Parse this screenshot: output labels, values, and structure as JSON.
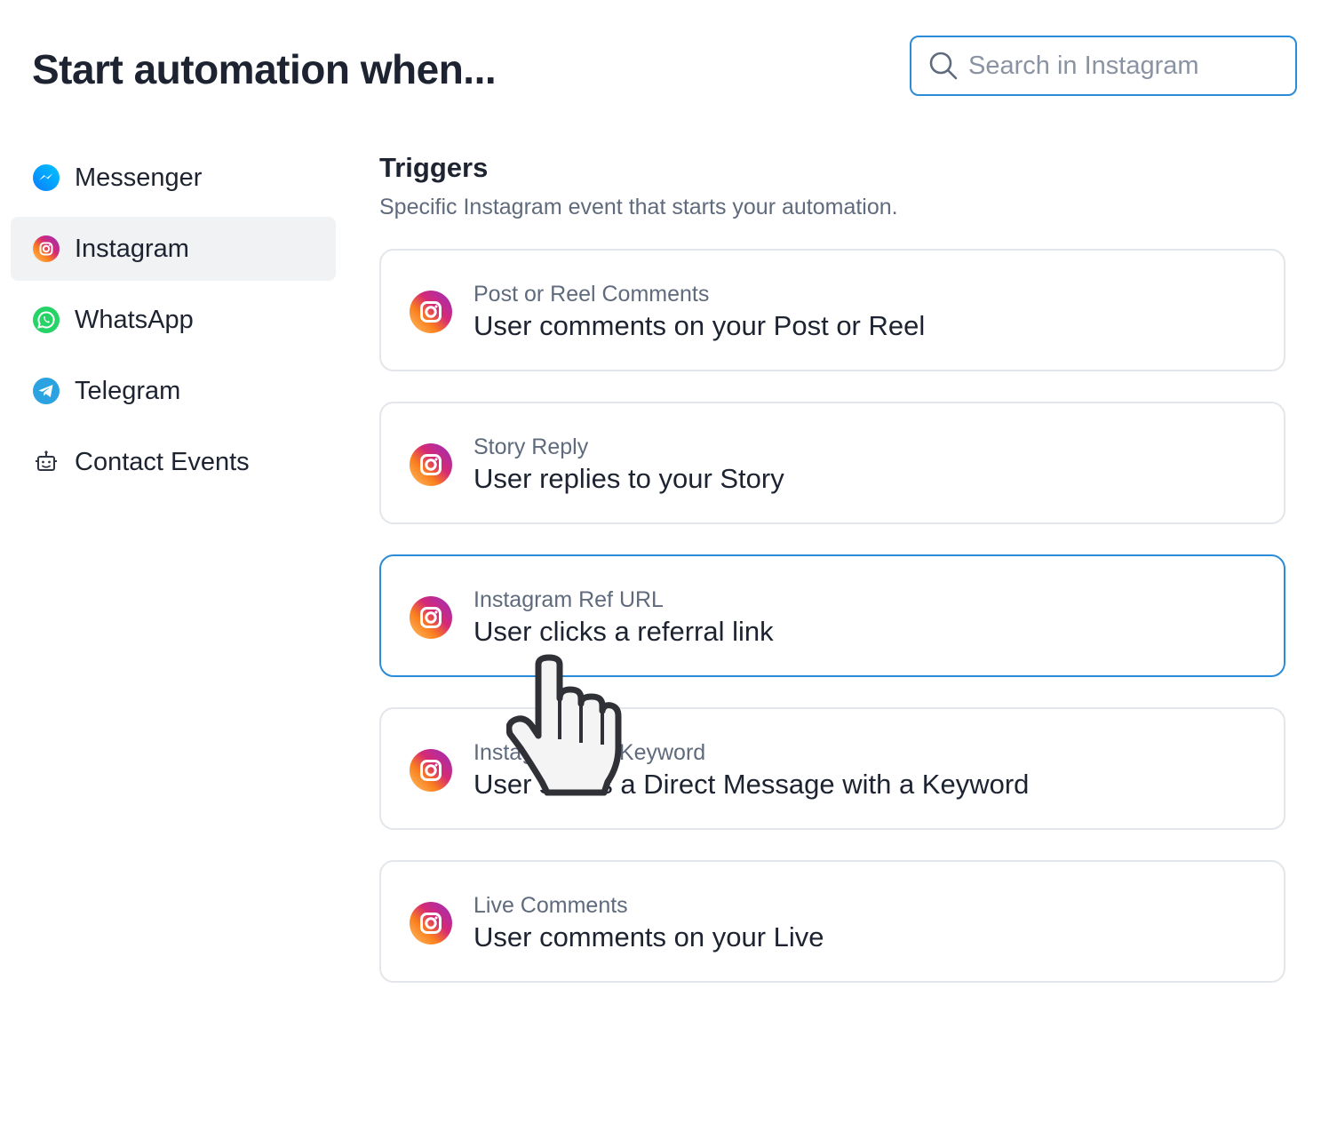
{
  "header": {
    "title": "Start automation when...",
    "search": {
      "placeholder": "Search in Instagram",
      "value": ""
    }
  },
  "sidebar": {
    "items": [
      {
        "label": "Messenger",
        "icon": "messenger-icon",
        "active": false
      },
      {
        "label": "Instagram",
        "icon": "instagram-icon",
        "active": true
      },
      {
        "label": "WhatsApp",
        "icon": "whatsapp-icon",
        "active": false
      },
      {
        "label": "Telegram",
        "icon": "telegram-icon",
        "active": false
      },
      {
        "label": "Contact Events",
        "icon": "contact-events-icon",
        "active": false
      }
    ]
  },
  "main": {
    "section_title": "Triggers",
    "section_subtitle": "Specific Instagram event that starts your automation.",
    "triggers": [
      {
        "kicker": "Post or Reel Comments",
        "title": "User comments on your Post or Reel",
        "icon": "instagram-icon",
        "selected": false
      },
      {
        "kicker": "Story Reply",
        "title": "User replies to your Story",
        "icon": "instagram-icon",
        "selected": false
      },
      {
        "kicker": "Instagram Ref URL",
        "title": "User clicks a referral link",
        "icon": "instagram-icon",
        "selected": true
      },
      {
        "kicker": "Instagram DM Keyword",
        "title": "User sends a Direct Message with a Keyword",
        "icon": "instagram-icon",
        "selected": false
      },
      {
        "kicker": "Live Comments",
        "title": "User comments on your Live",
        "icon": "instagram-icon",
        "selected": false
      }
    ]
  },
  "colors": {
    "accent": "#2a8bd8",
    "text_primary": "#1d2330",
    "text_secondary": "#5f6b7d",
    "card_border": "#e3e6ea",
    "sidebar_active_bg": "#f1f2f4",
    "messenger_blue": "#1877f2",
    "whatsapp_green": "#25d366",
    "telegram_blue": "#2aa3e0"
  },
  "cursor": {
    "icon": "hand-pointer-cursor-icon"
  }
}
